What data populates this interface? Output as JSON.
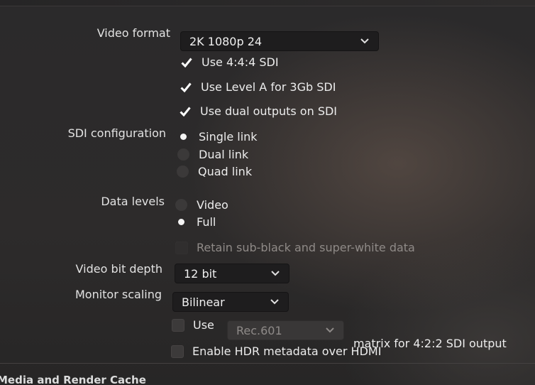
{
  "video_format": {
    "label": "Video format",
    "value": "2K 1080p 24"
  },
  "checkboxes_top": [
    {
      "label": "Use 4:4:4 SDI",
      "checked": true
    },
    {
      "label": "Use Level A for 3Gb SDI",
      "checked": true
    },
    {
      "label": "Use dual outputs on SDI",
      "checked": true
    }
  ],
  "sdi_configuration": {
    "label": "SDI configuration",
    "options": [
      "Single link",
      "Dual link",
      "Quad link"
    ],
    "selected": "Single link"
  },
  "data_levels": {
    "label": "Data levels",
    "options": [
      "Video",
      "Full"
    ],
    "selected": "Full",
    "retain_label": "Retain sub-black and super-white data",
    "retain_checked": false
  },
  "video_bit_depth": {
    "label": "Video bit depth",
    "value": "12 bit"
  },
  "monitor_scaling": {
    "label": "Monitor scaling",
    "value": "Bilinear"
  },
  "matrix": {
    "use_label": "Use",
    "value": "Rec.601",
    "suffix": "matrix for 4:2:2 SDI output",
    "checked": false
  },
  "hdr": {
    "label": "Enable HDR metadata over HDMI",
    "checked": false
  },
  "next_section": {
    "title": "Media and Render Cache"
  },
  "colors": {
    "accent_check": "#ffffff",
    "dropdown_bg": "#1e1d1e"
  }
}
